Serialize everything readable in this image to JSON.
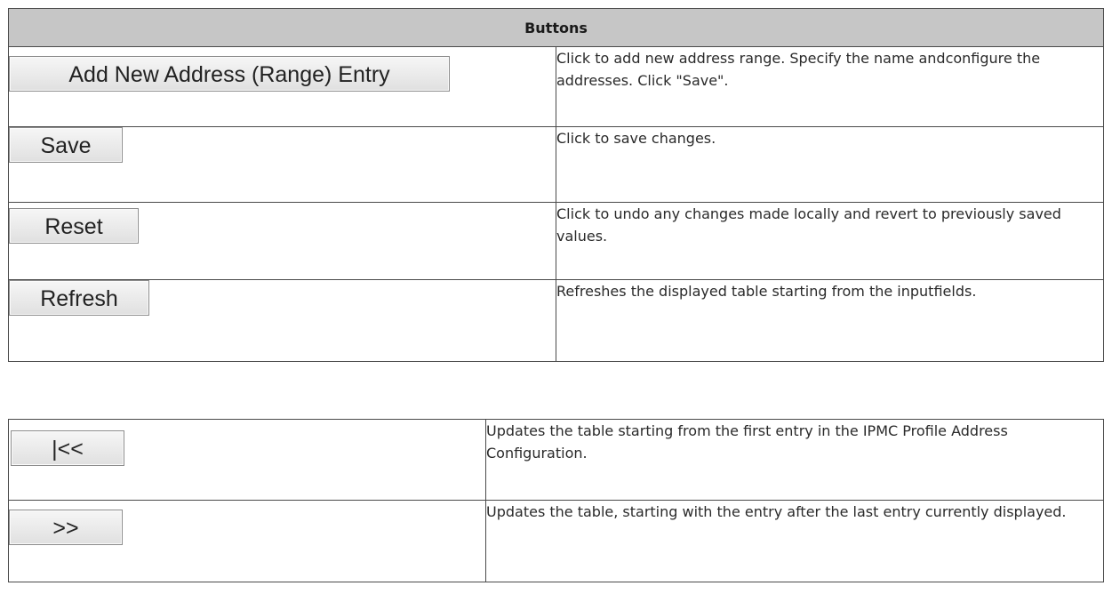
{
  "table1": {
    "header": "Buttons",
    "rows": [
      {
        "button_label": "Add New Address (Range) Entry",
        "description": "Click to add new address range. Specify the name andconfigure the addresses. Click \"Save\"."
      },
      {
        "button_label": "Save",
        "description": "Click to save changes."
      },
      {
        "button_label": "Reset",
        "description": "Click to undo any changes made locally and revert to  previously saved  values."
      },
      {
        "button_label": "Refresh",
        "description": "Refreshes the displayed table starting from the inputfields."
      }
    ]
  },
  "table2": {
    "rows": [
      {
        "button_label": "|<<",
        "description": "Updates the table starting from the first entry in the IPMC Profile Address Configuration."
      },
      {
        "button_label": ">>",
        "description": "Updates the table, starting with the entry after the last entry currently displayed."
      }
    ]
  }
}
